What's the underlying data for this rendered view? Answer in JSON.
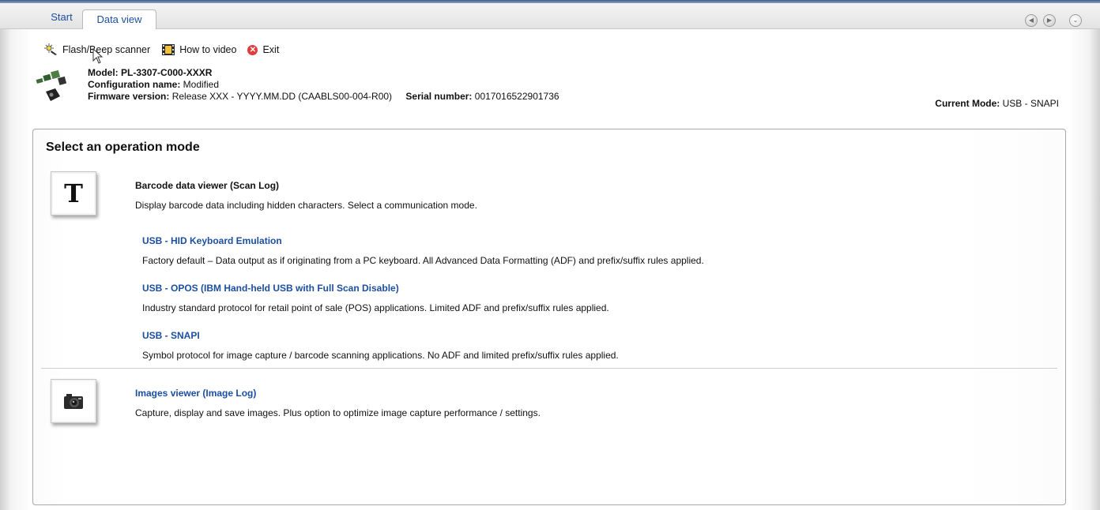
{
  "tabs": [
    {
      "label": "Start",
      "active": false
    },
    {
      "label": "Data view",
      "active": true
    }
  ],
  "toolbar": {
    "flash_label": "Flash/Beep scanner",
    "video_label": "How to video",
    "exit_label": "Exit"
  },
  "device": {
    "model_label": "Model:",
    "model_value": "PL-3307-C000-XXXR",
    "config_label": "Configuration name:",
    "config_value": "Modified",
    "firmware_label": "Firmware version:",
    "firmware_value": "Release XXX - YYYY.MM.DD (CAABLS00-004-R00)",
    "serial_label": "Serial number:",
    "serial_value": "0017016522901736",
    "mode_label": "Current Mode:",
    "mode_value": "USB - SNAPI"
  },
  "panel": {
    "title": "Select an operation mode",
    "barcode": {
      "title": "Barcode data viewer (Scan Log)",
      "desc": "Display barcode data including hidden characters. Select a communication mode.",
      "modes": [
        {
          "label": "USB - HID Keyboard Emulation",
          "desc": "Factory default – Data output as if originating from a PC keyboard. All Advanced Data Formatting (ADF) and prefix/suffix rules applied."
        },
        {
          "label": "USB - OPOS (IBM Hand-held USB with Full Scan Disable)",
          "desc": "Industry standard protocol for retail point of sale (POS) applications. Limited ADF and prefix/suffix rules applied."
        },
        {
          "label": "USB - SNAPI",
          "desc": "Symbol protocol for image capture / barcode scanning applications. No ADF and limited prefix/suffix rules applied."
        }
      ]
    },
    "images": {
      "title": "Images viewer (Image Log)",
      "desc": "Capture, display and save images. Plus option to optimize image capture performance / settings."
    },
    "t_icon_glyph": "T"
  },
  "colors": {
    "link": "#1c4fa0",
    "exit": "#e23b3b"
  }
}
